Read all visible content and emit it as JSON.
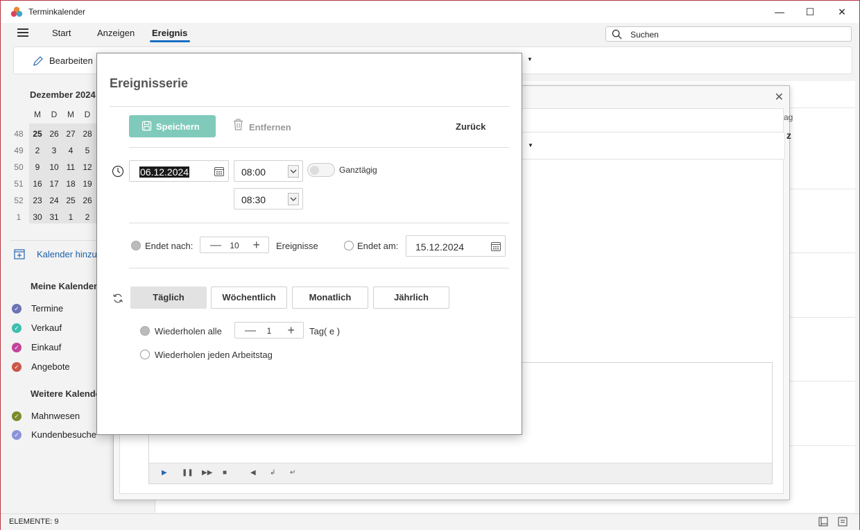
{
  "app": {
    "title": "Terminkalender"
  },
  "window_controls": {
    "minimize": "—",
    "maximize": "☐",
    "close": "✕"
  },
  "menu": {
    "items": [
      {
        "label": "Start"
      },
      {
        "label": "Anzeigen"
      },
      {
        "label": "Ereignis",
        "active": true
      }
    ]
  },
  "search": {
    "placeholder": "Suchen"
  },
  "ribbon": {
    "edit_label": "Bearbeiten"
  },
  "mini_calendar": {
    "month_label": "Dezember 2024",
    "weekday_headers": [
      "M",
      "D",
      "M",
      "D"
    ],
    "weeks": [
      {
        "week": "48",
        "days": [
          "25",
          "26",
          "27",
          "28"
        ]
      },
      {
        "week": "49",
        "days": [
          "2",
          "3",
          "4",
          "5"
        ]
      },
      {
        "week": "50",
        "days": [
          "9",
          "10",
          "11",
          "12"
        ]
      },
      {
        "week": "51",
        "days": [
          "16",
          "17",
          "18",
          "19"
        ]
      },
      {
        "week": "52",
        "days": [
          "23",
          "24",
          "25",
          "26"
        ]
      },
      {
        "week": "1",
        "days": [
          "30",
          "31",
          "1",
          "2"
        ]
      }
    ]
  },
  "sidebar": {
    "add_calendar": "Kalender hinzu",
    "my_calendars_title": "Meine Kalender",
    "my_calendars": [
      {
        "label": "Termine",
        "color": "#6b73b5"
      },
      {
        "label": "Verkauf",
        "color": "#3fbfae"
      },
      {
        "label": "Einkauf",
        "color": "#c2449a"
      },
      {
        "label": "Angebote",
        "color": "#c9574a"
      }
    ],
    "more_calendars_title": "Weitere Kalender",
    "more_calendars": [
      {
        "label": "Mahnwesen",
        "color": "#7c8b2e"
      },
      {
        "label": "Kundenbesuche",
        "color": "#8b93d8"
      }
    ]
  },
  "background_dialog": {
    "column_tag": "ag",
    "cell_z": "z"
  },
  "status": {
    "text": "ELEMENTE: 9"
  },
  "dialog": {
    "title": "Ereignisserie",
    "save_label": "Speichern",
    "remove_label": "Entfernen",
    "back_label": "Zurück",
    "start_date": "06.12.2024",
    "start_time": "08:00",
    "end_time": "08:30",
    "all_day_label": "Ganztägig",
    "all_day_on": false,
    "ends_after_label": "Endet nach:",
    "ends_after_count": "10",
    "events_label": "Ereignisse",
    "ends_on_label": "Endet am:",
    "ends_on_date": "15.12.2024",
    "tabs": [
      {
        "label": "Täglich",
        "active": true
      },
      {
        "label": "Wöchentlich"
      },
      {
        "label": "Monatlich"
      },
      {
        "label": "Jährlich"
      }
    ],
    "repeat_every_label": "Wiederholen alle",
    "repeat_every_count": "1",
    "repeat_unit": "Tag( e )",
    "repeat_workday_label": "Wiederholen jeden Arbeitstag"
  }
}
